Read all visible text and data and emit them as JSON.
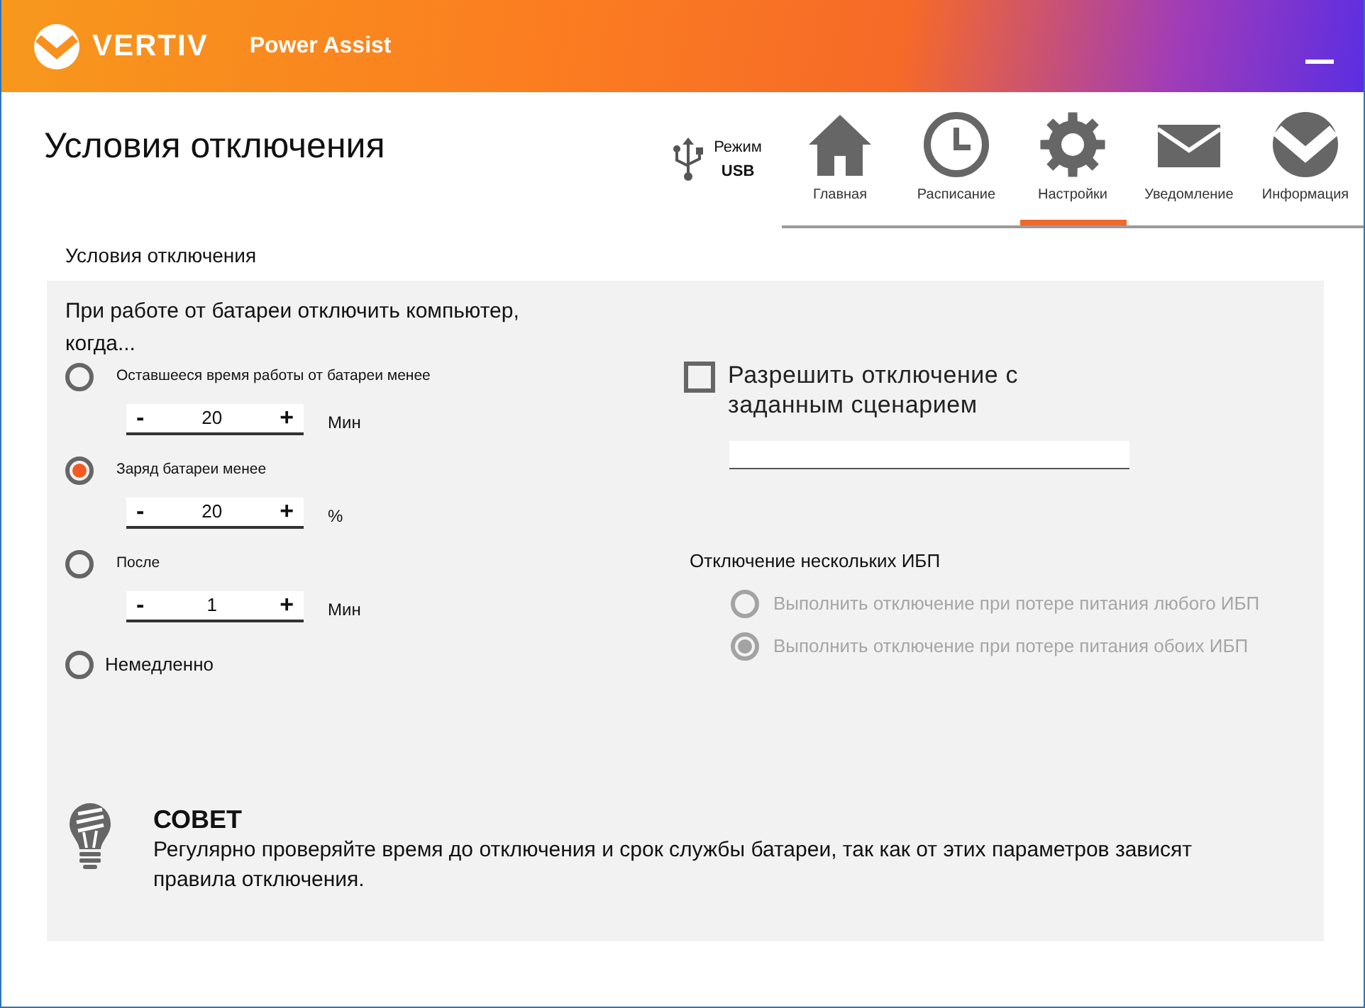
{
  "header": {
    "brand": "VERTIV",
    "app_name": "Power Assist"
  },
  "page_title": "Условия отключения",
  "connection": {
    "label": "Режим",
    "mode": "USB"
  },
  "tabs": [
    {
      "label": "Главная",
      "kind": "home",
      "selected": false
    },
    {
      "label": "Расписание",
      "kind": "schedule",
      "selected": false
    },
    {
      "label": "Настройки",
      "kind": "settings",
      "selected": true
    },
    {
      "label": "Уведомление",
      "kind": "notification",
      "selected": false
    },
    {
      "label": "Информация",
      "kind": "info",
      "selected": false
    }
  ],
  "section_title": "Условия отключения",
  "battery_shutdown": {
    "heading": "При работе от батареи отключить компьютер, когда...",
    "options": [
      {
        "kind": "stepper",
        "label": "Оставшееся время работы от батареи менее",
        "selected": false,
        "decrement": "-",
        "value": "20",
        "increment": "+",
        "unit": "Мин"
      },
      {
        "kind": "stepper",
        "label": "Заряд батареи менее",
        "selected": true,
        "decrement": "-",
        "value": "20",
        "increment": "+",
        "unit": "%"
      },
      {
        "kind": "stepper",
        "label": "После",
        "selected": false,
        "decrement": "-",
        "value": "1",
        "increment": "+",
        "unit": "Мин"
      },
      {
        "kind": "plain",
        "label": "Немедленно",
        "selected": false
      }
    ]
  },
  "script_shutdown": {
    "label": "Разрешить отключение с заданным сценарием",
    "checked": false
  },
  "multi_ups": {
    "title": "Отключение нескольких ИБП",
    "options": [
      {
        "label": "Выполнить отключение при потере питания любого ИБП",
        "selected": false,
        "disabled": true
      },
      {
        "label": "Выполнить отключение при потере питания обоих ИБП",
        "selected": true,
        "disabled": true
      }
    ]
  },
  "tip": {
    "title": "СОВЕТ",
    "text": "Регулярно проверяйте время до отключения и срок службы батареи, так как от этих параметров зависят правила отключения."
  }
}
